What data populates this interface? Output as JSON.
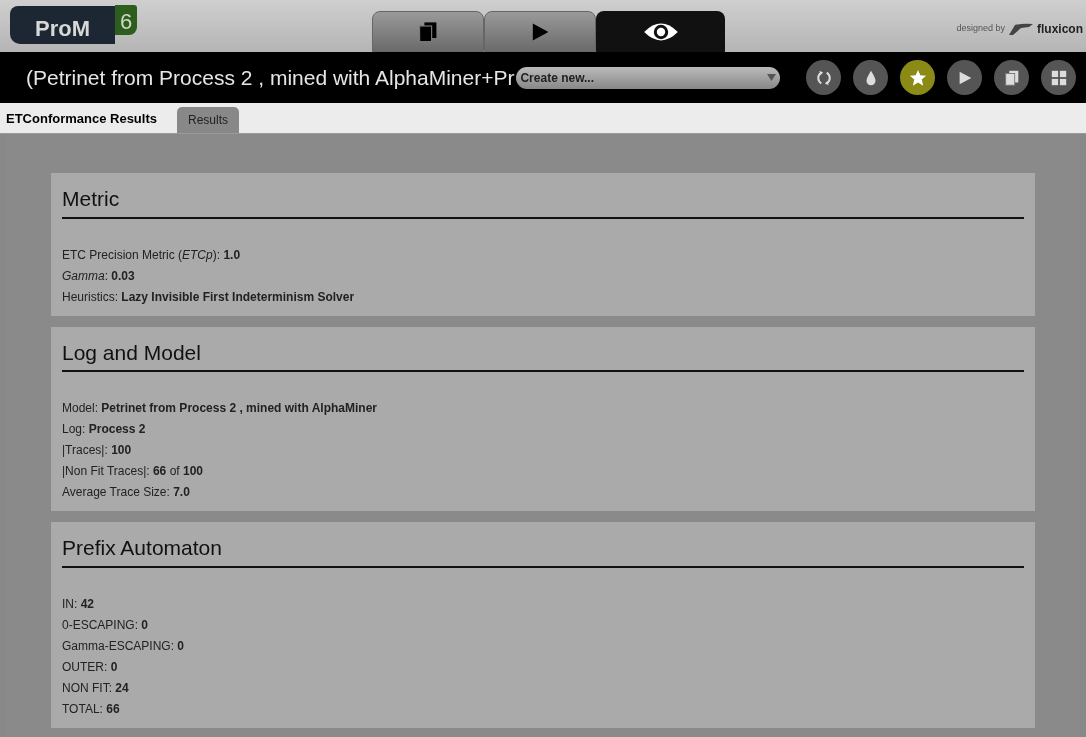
{
  "logo": {
    "name": "ProM",
    "version": "6"
  },
  "top_tabs": [
    {
      "kind": "copy",
      "selected": false
    },
    {
      "kind": "play",
      "selected": false
    },
    {
      "kind": "eye",
      "selected": true
    }
  ],
  "credit": {
    "prefix": "designed by",
    "brand": "fluxicon"
  },
  "toolbar": {
    "title": "(Petrinet from Process 2 , mined with AlphaMiner+Pr",
    "dropdown": "Create new...",
    "actions": [
      {
        "kind": "refresh",
        "selected": false
      },
      {
        "kind": "drop",
        "selected": false
      },
      {
        "kind": "star",
        "selected": true
      },
      {
        "kind": "play",
        "selected": false
      },
      {
        "kind": "copy",
        "selected": false
      },
      {
        "kind": "grid",
        "selected": false
      }
    ]
  },
  "view": {
    "title": "ETConformance Results",
    "tabs": [
      {
        "label": "Results",
        "selected": true
      }
    ]
  },
  "sections": [
    {
      "title": "Metric",
      "lines": [
        "ETC Precision Metric (*ETCp*): **1.0**",
        "*Gamma*: **0.03**",
        "Heuristics: **Lazy Invisible First Indeterminism Solver**"
      ]
    },
    {
      "title": "Log and Model",
      "lines": [
        "Model: **Petrinet from Process 2 , mined with AlphaMiner**",
        "Log: **Process 2**",
        "|Traces|: **100**",
        "|Non Fit Traces|: **66** of **100**",
        "Average Trace Size: **7.0**"
      ]
    },
    {
      "title": "Prefix Automaton",
      "lines": [
        "IN: **42**",
        "0-ESCAPING: **0**",
        "Gamma-ESCAPING: **0**",
        "OUTER: **0**",
        "NON FIT: **24**",
        "TOTAL: **66**"
      ]
    }
  ]
}
